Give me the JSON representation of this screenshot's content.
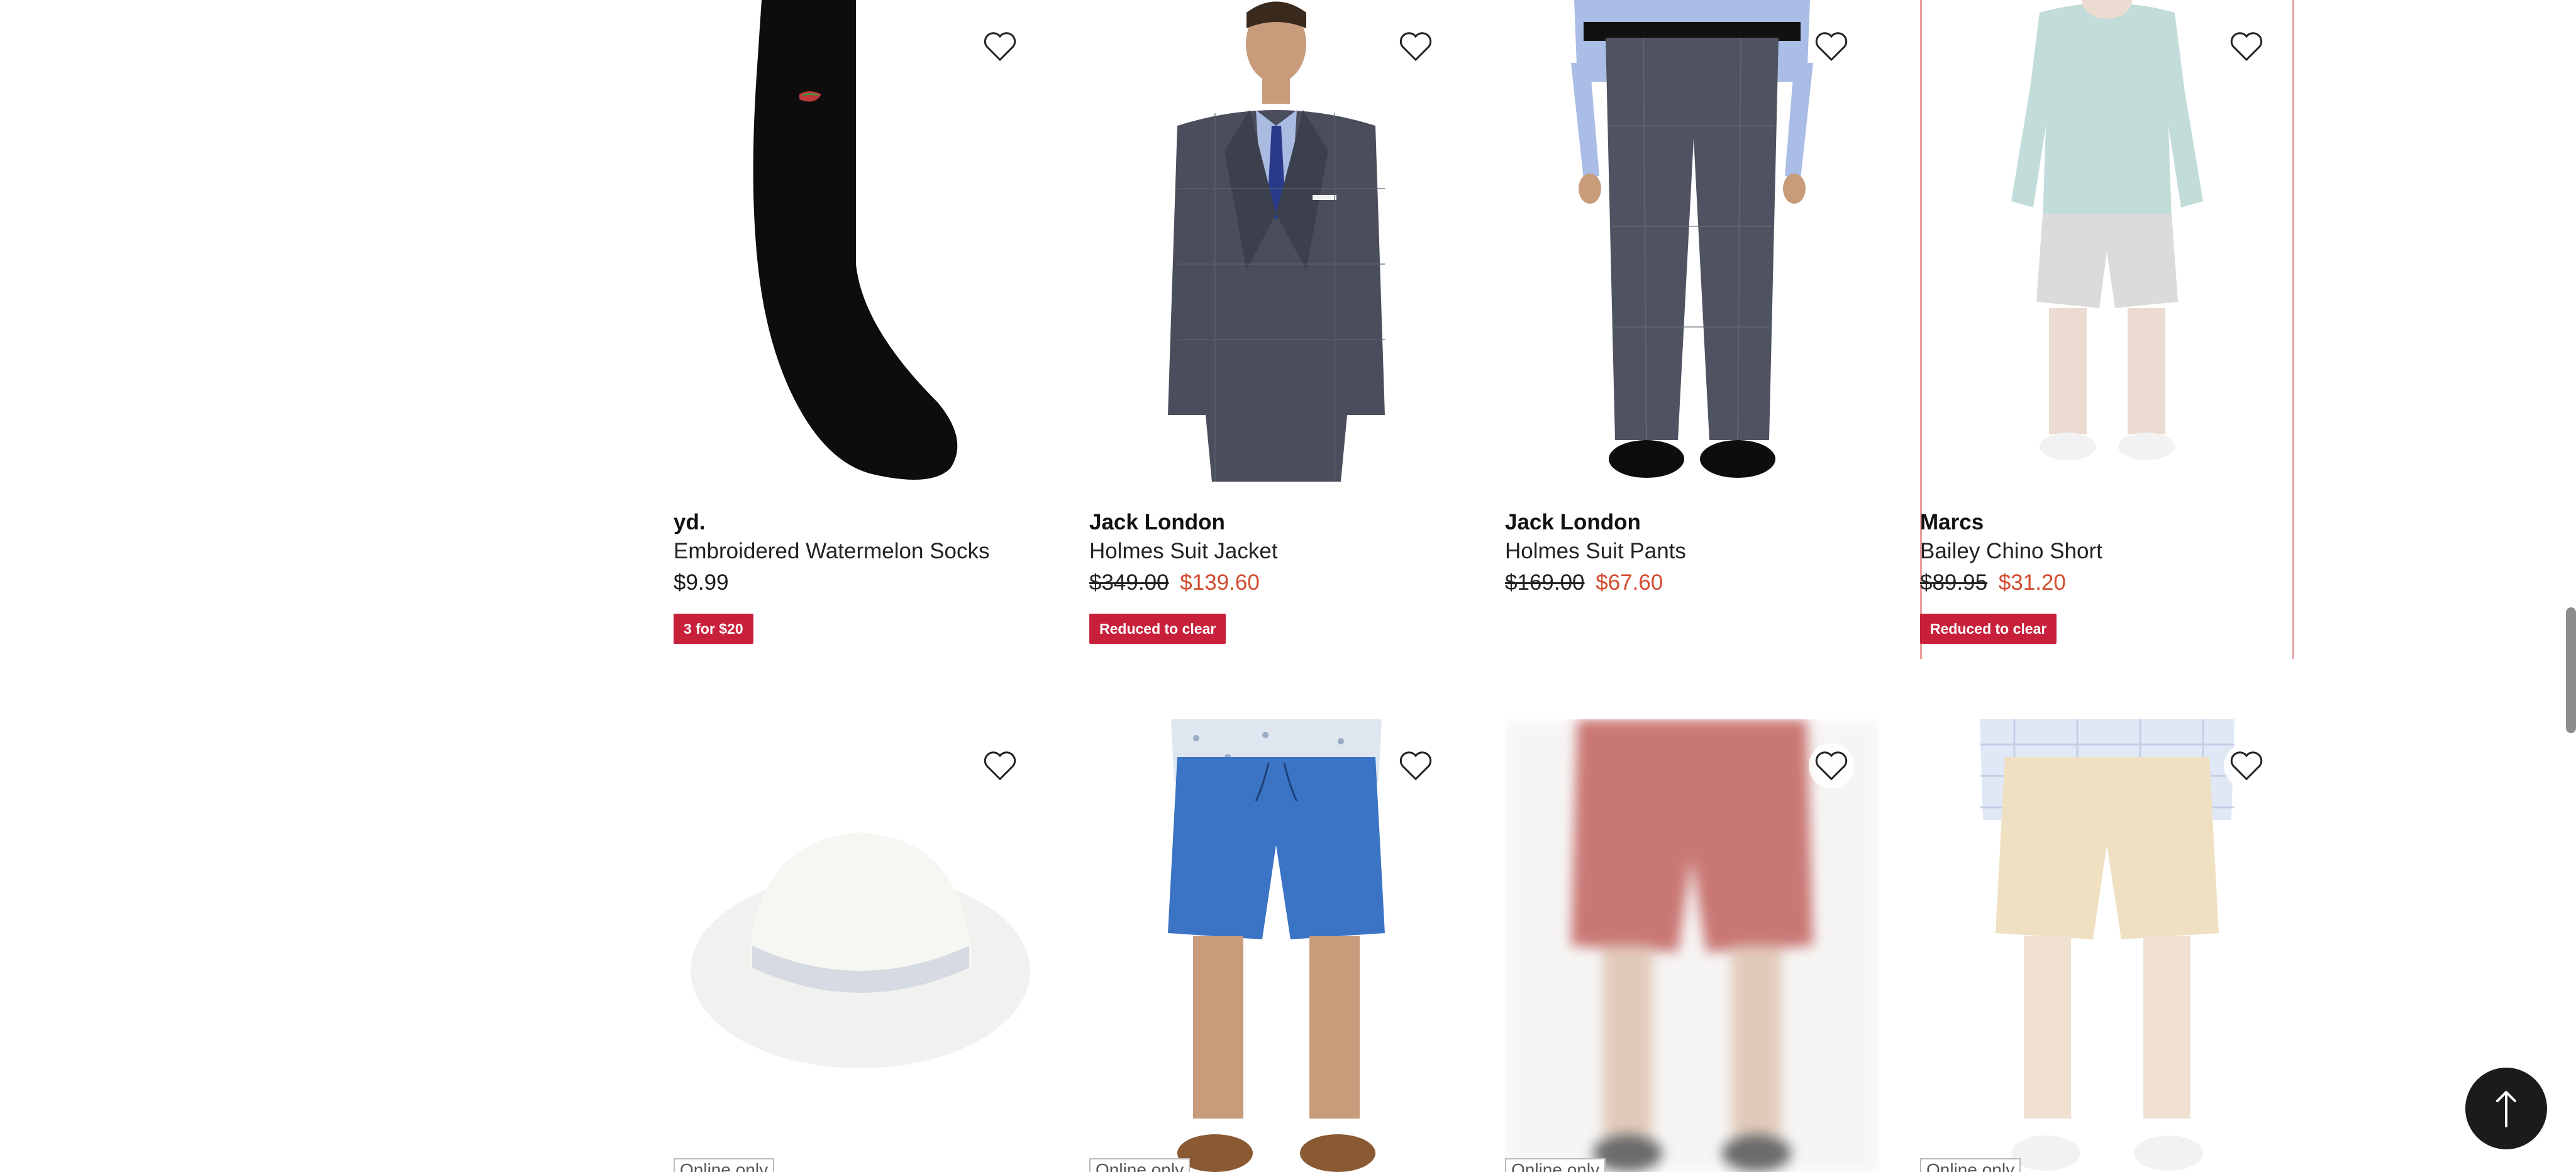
{
  "products_row1": [
    {
      "brand": "yd.",
      "name": "Embroidered Watermelon Socks",
      "price": "$9.99",
      "was_price": "",
      "now_price": "",
      "badge": "3 for $20",
      "image_icon": "sock-image"
    },
    {
      "brand": "Jack London",
      "name": "Holmes Suit Jacket",
      "price": "",
      "was_price": "$349.00",
      "now_price": "$139.60",
      "badge": "Reduced to clear",
      "image_icon": "suit-jacket-image"
    },
    {
      "brand": "Jack London",
      "name": "Holmes Suit Pants",
      "price": "",
      "was_price": "$169.00",
      "now_price": "$67.60",
      "badge": "",
      "image_icon": "suit-pants-image"
    },
    {
      "brand": "Marcs",
      "name": "Bailey Chino Short",
      "price": "",
      "was_price": "$89.95",
      "now_price": "$31.20",
      "badge": "Reduced to clear",
      "image_icon": "chino-short-image"
    }
  ],
  "products_row2": [
    {
      "tag": "Online only",
      "image_icon": "fedora-hat-image"
    },
    {
      "tag": "Online only",
      "image_icon": "blue-shorts-image"
    },
    {
      "tag": "Online only",
      "image_icon": "red-shorts-image"
    },
    {
      "tag": "Online only",
      "image_icon": "beige-shorts-image"
    }
  ],
  "colors": {
    "sale_price": "#d24b2e",
    "badge_bg": "#c8203b",
    "back_to_top_bg": "#1b1b1b"
  },
  "icons": {
    "wishlist": "heart-icon",
    "back_to_top": "arrow-up-icon"
  }
}
